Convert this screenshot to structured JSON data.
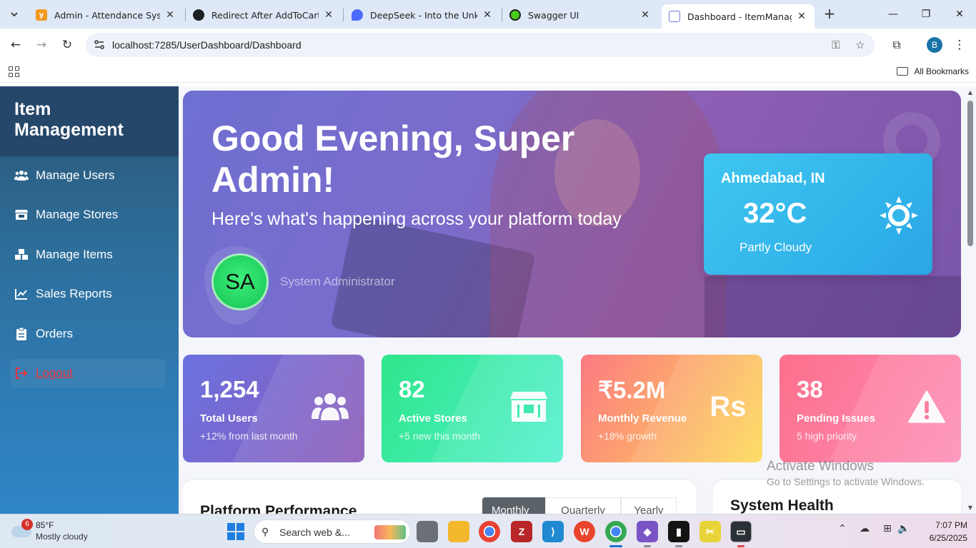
{
  "browser": {
    "tabs": [
      {
        "title": "Admin - Attendance System",
        "favicon_color": "#f29a1f",
        "favicon_glyph": "y"
      },
      {
        "title": "Redirect After AddToCart",
        "favicon_color": "#1b1f23",
        "favicon_glyph": ""
      },
      {
        "title": "DeepSeek - Into the Unknow",
        "favicon_color": "#4b6bfb",
        "favicon_glyph": ""
      },
      {
        "title": "Swagger UI",
        "favicon_color": "#49cc1a",
        "favicon_glyph": ""
      },
      {
        "title": "Dashboard - ItemManageme",
        "favicon_color": "#6b7bd6",
        "favicon_glyph": ""
      }
    ],
    "url": "localhost:7285/UserDashboard/Dashboard",
    "profile_initial": "B",
    "bookmarks_label": "All Bookmarks"
  },
  "sidebar": {
    "brand": "Item Management",
    "items": [
      {
        "label": "Manage Users",
        "icon": "users-icon"
      },
      {
        "label": "Manage Stores",
        "icon": "store-icon"
      },
      {
        "label": "Manage Items",
        "icon": "boxes-icon"
      },
      {
        "label": "Sales Reports",
        "icon": "chart-line-icon"
      },
      {
        "label": "Orders",
        "icon": "clipboard-icon"
      },
      {
        "label": "Logout",
        "icon": "logout-icon"
      }
    ]
  },
  "hero": {
    "greeting": "Good Evening, Super Admin!",
    "subtitle": "Here's what's happening across your platform today",
    "avatar_initials": "SA",
    "role": "System Administrator",
    "weather": {
      "city": "Ahmedabad, IN",
      "temperature": "32°C",
      "condition": "Partly Cloudy",
      "icon": "sun-icon"
    }
  },
  "stats": [
    {
      "value": "1,254",
      "label": "Total Users",
      "sub": "+12% from last month",
      "icon": "users-icon",
      "gradient": [
        "#6b72e0",
        "#8a5ab8"
      ]
    },
    {
      "value": "82",
      "label": "Active Stores",
      "sub": "+5 new this month",
      "icon": "store-icon",
      "gradient": [
        "#2ee68a",
        "#53f0d0"
      ]
    },
    {
      "value": "₹5.2M",
      "label": "Monthly Revenue",
      "sub": "+18% growth",
      "icon": "rupee-icon",
      "icon_text": "Rs",
      "gradient": [
        "#fb7a82",
        "#fddb56"
      ]
    },
    {
      "value": "38",
      "label": "Pending Issues",
      "sub": "5 high priority",
      "icon": "warning-icon",
      "gradient": [
        "#fd6f8c",
        "#fd90b8"
      ]
    }
  ],
  "performance": {
    "title": "Platform Performance",
    "periods": [
      "Monthly",
      "Quarterly",
      "Yearly"
    ],
    "active_period": "Monthly"
  },
  "system_health": {
    "title": "System Health"
  },
  "watermark": {
    "line1": "Activate Windows",
    "line2": "Go to Settings to activate Windows."
  },
  "taskbar": {
    "weather_temp": "85°F",
    "weather_desc": "Mostly cloudy",
    "weather_badge": "6",
    "search_placeholder": "Search web &...",
    "time": "7:07 PM",
    "date": "6/25/2025"
  }
}
